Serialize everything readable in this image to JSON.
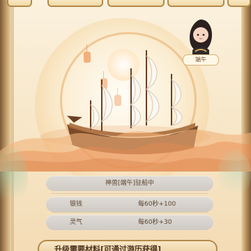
{
  "header": {
    "tabs": [
      {
        "label": ""
      },
      {
        "label": ""
      },
      {
        "label": ""
      },
      {
        "label": ""
      },
      {
        "label": ""
      }
    ]
  },
  "avatar": {
    "name": "端午"
  },
  "ship": {
    "status_text": "神兽[端午]驻船中",
    "stats": [
      {
        "label": "银钱",
        "value": "每60秒+100"
      },
      {
        "label": "灵气",
        "value": "每60秒+30"
      }
    ]
  },
  "bottom": {
    "hint": "升级需要材料[可通过游历获得]"
  }
}
